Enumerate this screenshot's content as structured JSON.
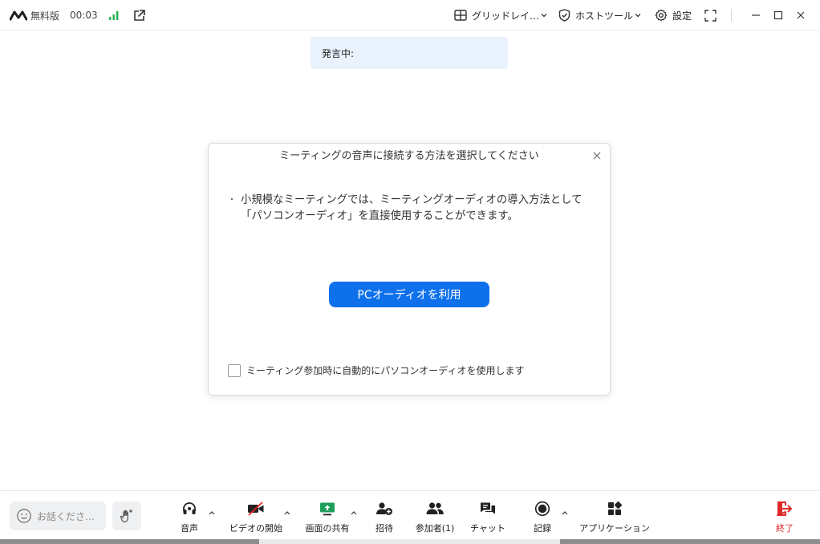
{
  "topbar": {
    "free_label": "無料版",
    "timer": "00:03",
    "grid_view_label": "グリッドレイ…",
    "host_tools_label": "ホストツール",
    "settings_label": "設定"
  },
  "speaking": {
    "label": "発言中:"
  },
  "dialog": {
    "title": "ミーティングの音声に接続する方法を選択してください",
    "bullet": "・",
    "text": "小規模なミーティングでは、ミーティングオーディオの導入方法として「パソコンオーディオ」を直接使用することができます。",
    "button_label": "PCオーディオを利用",
    "checkbox_label": "ミーティング参加時に自動的にパソコンオーディオを使用します",
    "checkbox_checked": false
  },
  "toolbar": {
    "say_placeholder": "お話くださ…",
    "items": {
      "audio": "音声",
      "video": "ビデオの開始",
      "share": "画面の共有",
      "invite": "招待",
      "participants": "参加者(1)",
      "chat": "チャット",
      "record": "記録",
      "apps": "アプリケーション",
      "end": "終了"
    }
  },
  "colors": {
    "accent": "#0e71eb",
    "signal": "#23b14d",
    "share": "#1e9e5a",
    "end": "#e02828",
    "banner_bg": "#e9f1fc"
  },
  "icons": [
    "logo-icon",
    "signal-icon",
    "popout-icon",
    "grid-icon",
    "shield-icon",
    "gear-icon",
    "fullscreen-icon",
    "minimize-icon",
    "maximize-icon",
    "close-icon",
    "smiley-icon",
    "raise-hand-icon",
    "headphone-icon",
    "video-off-icon",
    "share-screen-icon",
    "add-user-icon",
    "participants-icon",
    "chat-icon",
    "record-icon",
    "apps-icon",
    "leave-icon"
  ]
}
